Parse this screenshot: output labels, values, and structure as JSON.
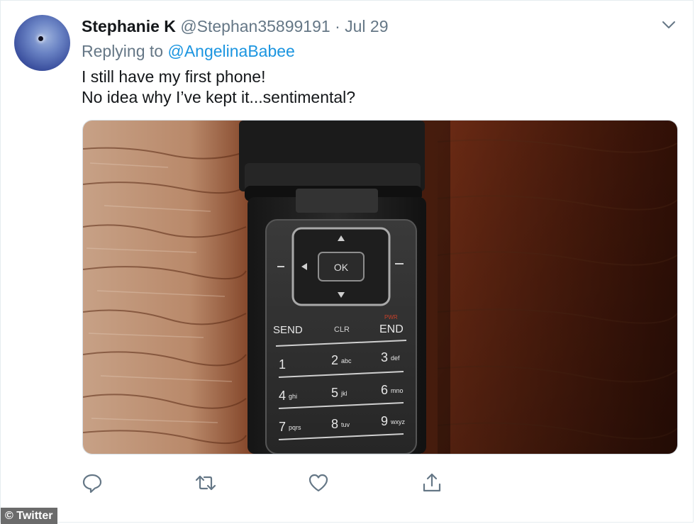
{
  "tweet": {
    "author_name": "Stephanie K",
    "author_handle": "@Stephan35899191",
    "separator": "·",
    "date": "Jul 29",
    "replying_prefix": "Replying to",
    "replying_mention": "@AngelinaBabee",
    "text_line_1": "I still have my first phone!",
    "text_line_2": "No idea why I’ve kept it...sentimental?"
  },
  "photo": {
    "keypad": {
      "ok": "OK",
      "send": "SEND",
      "clr": "CLR",
      "end": "END",
      "pwr": "PWR",
      "keys": [
        {
          "digit": "1",
          "letters": ""
        },
        {
          "digit": "2",
          "letters": "abc"
        },
        {
          "digit": "3",
          "letters": "def"
        },
        {
          "digit": "4",
          "letters": "ghi"
        },
        {
          "digit": "5",
          "letters": "jkl"
        },
        {
          "digit": "6",
          "letters": "mno"
        },
        {
          "digit": "7",
          "letters": "pqrs"
        },
        {
          "digit": "8",
          "letters": "tuv"
        },
        {
          "digit": "9",
          "letters": "wxyz"
        }
      ]
    }
  },
  "actions": {
    "icons": [
      "reply-icon",
      "retweet-icon",
      "like-icon",
      "share-icon"
    ]
  },
  "watermark": "© Twitter",
  "colors": {
    "link": "#1b95e0",
    "secondary_text": "#657786",
    "primary_text": "#14171a",
    "watermark_bg": "#6b6b6b"
  }
}
